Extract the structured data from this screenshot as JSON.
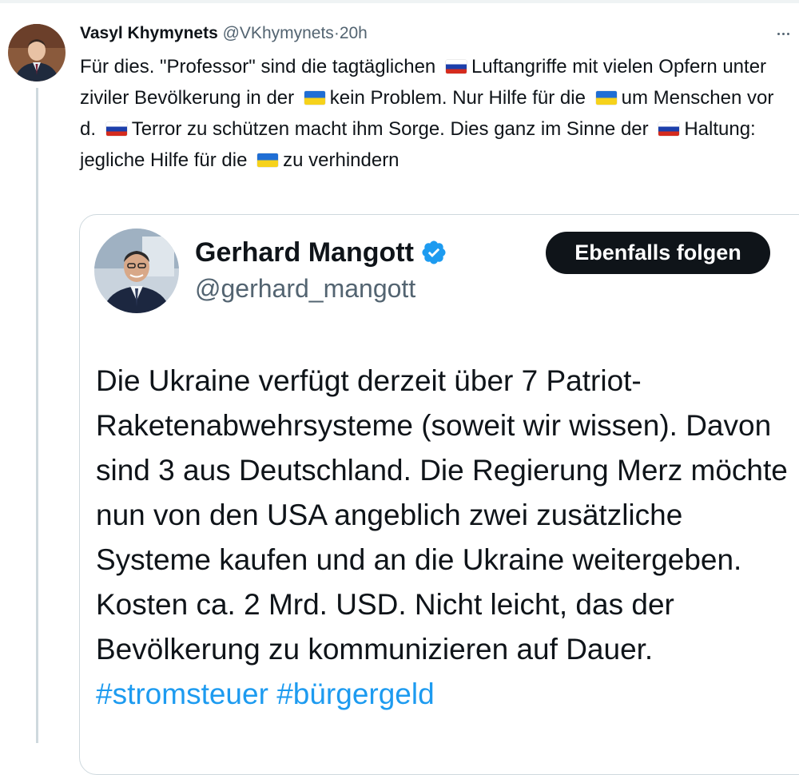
{
  "tweet": {
    "author_name": "Vasyl Khymynets",
    "author_handle": "@VKhymynets",
    "separator": "·",
    "time": "20h",
    "text_parts": [
      "Für dies. \"Professor\" sind die tagtäglichen ",
      "Luftangriffe mit vielen Opfern unter ziviler Bevölkerung in der ",
      "kein Problem. Nur Hilfe für die ",
      "um Menschen vor d. ",
      "Terror zu schützen macht ihm Sorge. Dies ganz im Sinne der ",
      "Haltung:  jegliche Hilfe für die ",
      "zu verhindern"
    ],
    "flags": [
      "russia-flag-icon",
      "ukraine-flag-icon",
      "ukraine-flag-icon",
      "russia-flag-icon",
      "russia-flag-icon",
      "ukraine-flag-icon"
    ]
  },
  "quote": {
    "author_name": "Gerhard Mangott",
    "author_handle": "@gerhard_mangott",
    "follow_label": "Ebenfalls folgen",
    "text": "Die Ukraine verfügt derzeit über 7 Patriot-Raketenabwehrsysteme (soweit wir wissen). Davon sind 3 aus Deutschland. Die Regierung Merz möchte nun von den USA angeblich zwei zusätzliche Systeme kaufen und an die Ukraine weitergeben. Kosten ca. 2 Mrd. USD. Nicht leicht, das der Bevölkerung zu kommunizieren auf Dauer. ",
    "hashtags": [
      "#stromsteuer",
      "#bürgergeld"
    ]
  },
  "colors": {
    "text": "#0f1419",
    "secondary": "#536471",
    "link": "#1d9bf0",
    "verified": "#1d9bf0",
    "button_bg": "#0f1419"
  }
}
